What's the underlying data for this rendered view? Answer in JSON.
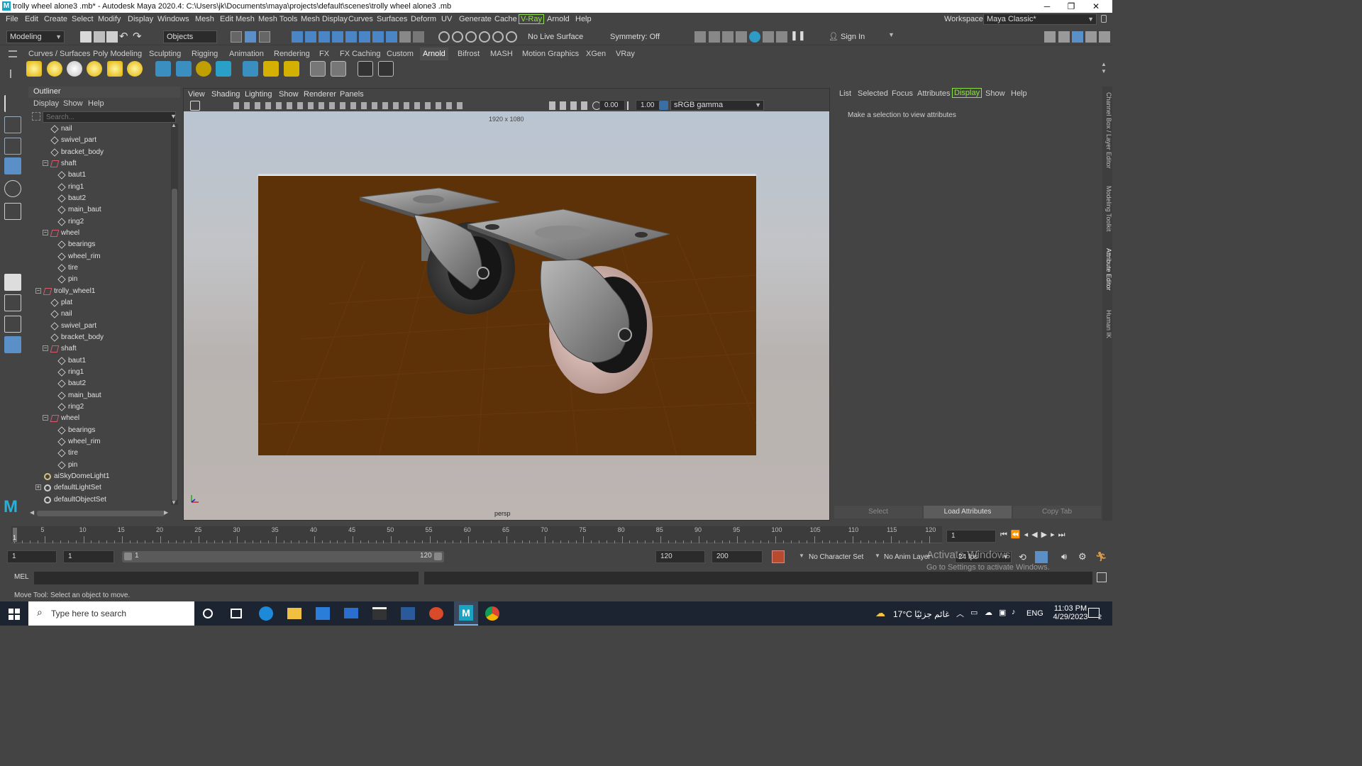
{
  "title_bar": {
    "text": "trolly wheel alone3 .mb* - Autodesk Maya 2020.4: C:\\Users\\jk\\Documents\\maya\\projects\\default\\scenes\\trolly wheel alone3 .mb",
    "minimize": "─",
    "maximize": "❐",
    "close": "✕"
  },
  "menus": [
    "File",
    "Edit",
    "Create",
    "Select",
    "Modify",
    "Display",
    "Windows",
    "Mesh",
    "Edit Mesh",
    "Mesh Tools",
    "Mesh Display",
    "Curves",
    "Surfaces",
    "Deform",
    "UV",
    "Generate",
    "Cache",
    "V-Ray",
    "Arnold",
    "Help"
  ],
  "workspace": {
    "label": "Workspace :",
    "value": "Maya Classic*"
  },
  "status_line": {
    "menu_set": "Modeling",
    "select_mode": "Objects",
    "live_surface": "No Live Surface",
    "symmetry": "Symmetry: Off",
    "sign_in": "Sign In"
  },
  "shelf_tabs": [
    "Curves / Surfaces",
    "Poly Modeling",
    "Sculpting",
    "Rigging",
    "Animation",
    "Rendering",
    "FX",
    "FX Caching",
    "Custom",
    "Arnold",
    "Bifrost",
    "MASH",
    "Motion Graphics",
    "XGen",
    "VRay"
  ],
  "shelf_active": "Arnold",
  "outliner": {
    "title": "Outliner",
    "menus": [
      "Display",
      "Show",
      "Help"
    ],
    "search_placeholder": "Search...",
    "rows": [
      {
        "label": "nail",
        "indent": 1,
        "type": "mesh"
      },
      {
        "label": "swivel_part",
        "indent": 1,
        "type": "mesh"
      },
      {
        "label": "bracket_body",
        "indent": 1,
        "type": "mesh"
      },
      {
        "label": "shaft",
        "indent": 1,
        "type": "group",
        "expanded": true
      },
      {
        "label": "baut1",
        "indent": 2,
        "type": "mesh"
      },
      {
        "label": "ring1",
        "indent": 2,
        "type": "mesh"
      },
      {
        "label": "baut2",
        "indent": 2,
        "type": "mesh"
      },
      {
        "label": "main_baut",
        "indent": 2,
        "type": "mesh"
      },
      {
        "label": "ring2",
        "indent": 2,
        "type": "mesh"
      },
      {
        "label": "wheel",
        "indent": 1,
        "type": "group",
        "expanded": true
      },
      {
        "label": "bearings",
        "indent": 2,
        "type": "mesh"
      },
      {
        "label": "wheel_rim",
        "indent": 2,
        "type": "mesh"
      },
      {
        "label": "tire",
        "indent": 2,
        "type": "mesh"
      },
      {
        "label": "pin",
        "indent": 2,
        "type": "mesh"
      },
      {
        "label": "trolly_wheel1",
        "indent": 0,
        "type": "group",
        "expanded": true
      },
      {
        "label": "plat",
        "indent": 1,
        "type": "mesh"
      },
      {
        "label": "nail",
        "indent": 1,
        "type": "mesh"
      },
      {
        "label": "swivel_part",
        "indent": 1,
        "type": "mesh"
      },
      {
        "label": "bracket_body",
        "indent": 1,
        "type": "mesh"
      },
      {
        "label": "shaft",
        "indent": 1,
        "type": "group",
        "expanded": true
      },
      {
        "label": "baut1",
        "indent": 2,
        "type": "mesh"
      },
      {
        "label": "ring1",
        "indent": 2,
        "type": "mesh"
      },
      {
        "label": "baut2",
        "indent": 2,
        "type": "mesh"
      },
      {
        "label": "main_baut",
        "indent": 2,
        "type": "mesh"
      },
      {
        "label": "ring2",
        "indent": 2,
        "type": "mesh"
      },
      {
        "label": "wheel",
        "indent": 1,
        "type": "group",
        "expanded": true
      },
      {
        "label": "bearings",
        "indent": 2,
        "type": "mesh"
      },
      {
        "label": "wheel_rim",
        "indent": 2,
        "type": "mesh"
      },
      {
        "label": "tire",
        "indent": 2,
        "type": "mesh"
      },
      {
        "label": "pin",
        "indent": 2,
        "type": "mesh"
      },
      {
        "label": "aiSkyDomeLight1",
        "indent": 0,
        "type": "light"
      },
      {
        "label": "defaultLightSet",
        "indent": 0,
        "type": "set",
        "collapsed": true
      },
      {
        "label": "defaultObjectSet",
        "indent": 0,
        "type": "set"
      }
    ]
  },
  "viewport": {
    "menus": [
      "View",
      "Shading",
      "Lighting",
      "Show",
      "Renderer",
      "Panels"
    ],
    "exposure": "0.00",
    "gamma": "1.00",
    "color_space": "sRGB gamma",
    "resolution": "1920 x 1080",
    "camera": "persp"
  },
  "attribute_editor": {
    "menus": [
      "List",
      "Selected",
      "Focus",
      "Attributes",
      "Display",
      "Show",
      "Help"
    ],
    "message": "Make a selection to view attributes",
    "buttons": [
      "Select",
      "Load Attributes",
      "Copy Tab"
    ]
  },
  "right_tabs": [
    "Channel Box / Layer Editor",
    "Modeling Toolkit",
    "Attribute Editor",
    "Human IK"
  ],
  "timeline": {
    "ticks": [
      "5",
      "10",
      "15",
      "20",
      "25",
      "30",
      "35",
      "40",
      "45",
      "50",
      "55",
      "60",
      "65",
      "70",
      "75",
      "80",
      "85",
      "90",
      "95",
      "100",
      "105",
      "110",
      "115",
      "120"
    ],
    "start": "1",
    "current_frame": "1"
  },
  "range": {
    "start": "1",
    "anim_start": "1",
    "slider_start": "1",
    "slider_end": "120",
    "end": "120",
    "anim_end": "200",
    "character_set": "No Character Set",
    "anim_layer": "No Anim Layer",
    "fps": "24 fps"
  },
  "activate_windows": {
    "line1": "Activate Windows",
    "line2": "Go to Settings to activate Windows."
  },
  "cmdline": {
    "label": "MEL"
  },
  "help_line": "Move Tool: Select an object to move.",
  "taskbar": {
    "search_placeholder": "Type here to search",
    "weather": "17°C  غائم جزئيًا",
    "lang": "ENG",
    "time": "11:03 PM",
    "date": "4/29/2023",
    "notifications": "2"
  }
}
